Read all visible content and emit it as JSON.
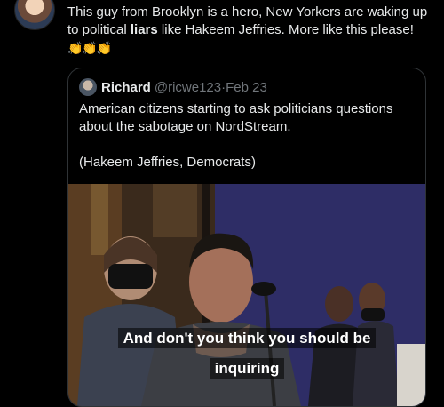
{
  "post": {
    "text_before": "This guy from Brooklyn is a hero, New Yorkers are waking up to political ",
    "text_bold": "liars",
    "text_after": " like Hakeem Jeffries.  More like this please! ",
    "emoji": "👏👏👏"
  },
  "quoted_tweet": {
    "author_name": "Richard",
    "handle": "@ricwe123",
    "separator": " · ",
    "date": "Feb 23",
    "text": "American citizens starting to ask politicians questions about the sabotage on NordStream.\n\n(Hakeem Jeffries, Democrats)"
  },
  "video": {
    "caption_line1": "And don't you think you should be",
    "caption_line2": "inquiring"
  }
}
